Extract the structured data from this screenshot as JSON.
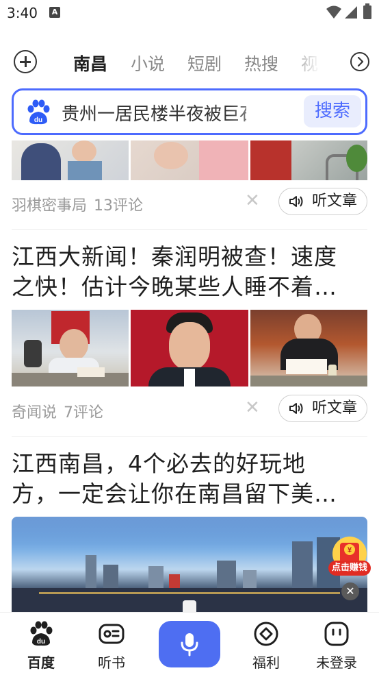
{
  "status_bar": {
    "time": "3:40",
    "notification_letter": "A"
  },
  "channels": {
    "tabs": [
      {
        "label": "南昌",
        "active": true
      },
      {
        "label": "小说",
        "active": false
      },
      {
        "label": "短剧",
        "active": false
      },
      {
        "label": "热搜",
        "active": false
      },
      {
        "label": "视",
        "active": false
      }
    ]
  },
  "search": {
    "query": "贵州一居民楼半夜被巨石",
    "button_label": "搜索"
  },
  "feed": {
    "items": [
      {
        "source": "羽棋密事局",
        "comments": "13评论",
        "listen_label": "听文章"
      },
      {
        "headline_line1": "江西大新闻！秦润明被查！速度",
        "headline_line2": "之快！估计今晚某些人睡不着…",
        "source": "奇闻说",
        "comments": "7评论",
        "listen_label": "听文章"
      },
      {
        "headline_line1": "江西南昌，4个必去的好玩地",
        "headline_line2": "方，一定会让你在南昌留下美…"
      }
    ]
  },
  "reward": {
    "label": "点击赚钱",
    "symbol": "¥"
  },
  "bottom_nav": {
    "items": [
      {
        "label": "百度",
        "active": true
      },
      {
        "label": "听书",
        "active": false
      },
      {
        "label": "福利",
        "active": false
      },
      {
        "label": "未登录",
        "active": false
      }
    ]
  },
  "colors": {
    "accent": "#4e6ef2",
    "search_border": "#4d6bfe",
    "reward_red": "#e12b22"
  }
}
